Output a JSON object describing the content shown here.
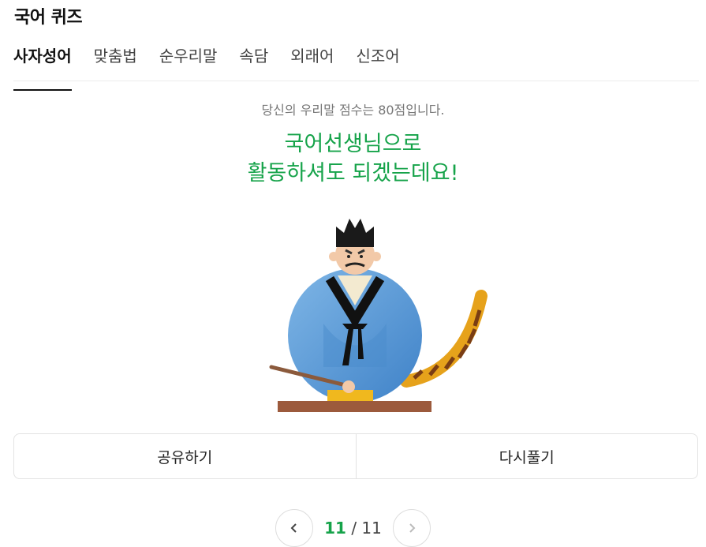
{
  "header": {
    "title": "국어 퀴즈"
  },
  "tabs": [
    {
      "label": "사자성어",
      "active": true
    },
    {
      "label": "맞춤법"
    },
    {
      "label": "순우리말"
    },
    {
      "label": "속담"
    },
    {
      "label": "외래어"
    },
    {
      "label": "신조어"
    }
  ],
  "result": {
    "score_text": "당신의 우리말 점수는 80점입니다.",
    "headline_line1": "국어선생님으로",
    "headline_line2": "활동하셔도 되겠는데요!"
  },
  "actions": {
    "share_label": "공유하기",
    "retry_label": "다시풀기"
  },
  "pager": {
    "current": "11",
    "separator": "/",
    "total": "11"
  },
  "colors": {
    "accent": "#16a34a",
    "robe": "#5b9bd5",
    "text": "#222222"
  }
}
